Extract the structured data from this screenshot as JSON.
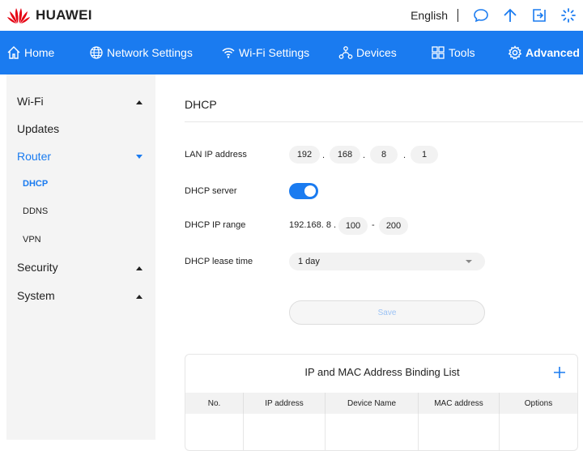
{
  "brand": {
    "name": "HUAWEI",
    "color": "#e60012"
  },
  "topbar": {
    "language": "English",
    "icons": [
      "chat-icon",
      "upload-arrow-icon",
      "logout-icon",
      "loading-spinner-icon"
    ]
  },
  "nav": {
    "accent": "#1a7bf0",
    "items": [
      {
        "label": "Home",
        "icon": "home-icon"
      },
      {
        "label": "Network Settings",
        "icon": "globe-icon"
      },
      {
        "label": "Wi-Fi Settings",
        "icon": "wifi-icon"
      },
      {
        "label": "Devices",
        "icon": "devices-icon"
      },
      {
        "label": "Tools",
        "icon": "tools-icon"
      },
      {
        "label": "Advanced",
        "icon": "gear-icon",
        "active": true
      }
    ]
  },
  "sidebar": {
    "items": [
      {
        "label": "Wi-Fi",
        "caret": "up"
      },
      {
        "label": "Updates"
      },
      {
        "label": "Router",
        "caret": "down",
        "active": true
      },
      {
        "label": "DHCP",
        "sub": true,
        "active": true
      },
      {
        "label": "DDNS",
        "sub": true
      },
      {
        "label": "VPN",
        "sub": true
      },
      {
        "label": "Security",
        "caret": "up"
      },
      {
        "label": "System",
        "caret": "up"
      }
    ]
  },
  "main": {
    "title": "DHCP",
    "lan_ip": {
      "label": "LAN IP address",
      "octets": [
        "192",
        "168",
        "8",
        "1"
      ],
      "separator": "."
    },
    "dhcp_server": {
      "label": "DHCP server",
      "enabled": true
    },
    "dhcp_range": {
      "label": "DHCP IP range",
      "prefix": "192.168. 8 .",
      "start": "100",
      "dash": "-",
      "end": "200"
    },
    "lease": {
      "label": "DHCP lease time",
      "value": "1 day"
    },
    "save_label": "Save"
  },
  "binding": {
    "title": "IP and MAC Address Binding List",
    "columns": [
      "No.",
      "IP address",
      "Device Name",
      "MAC address",
      "Options"
    ],
    "rows": []
  }
}
